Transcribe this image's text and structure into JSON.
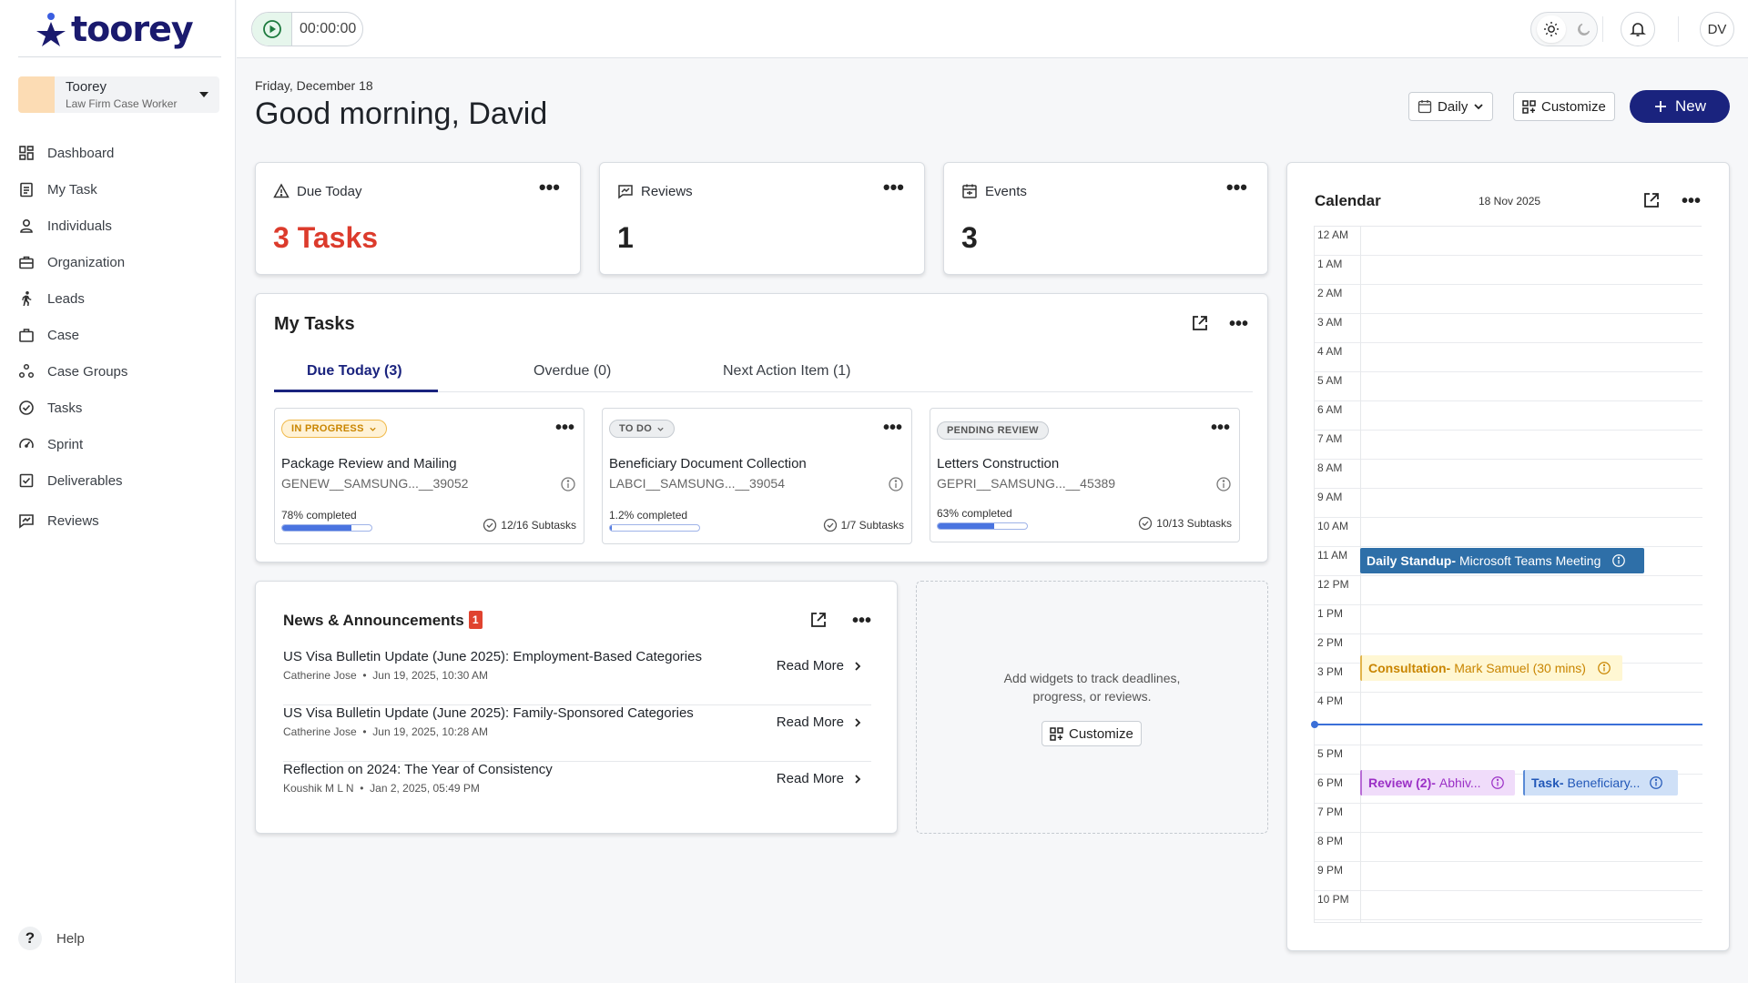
{
  "brand": {
    "name": "toorey",
    "color": "#1a1a6e"
  },
  "org": {
    "name": "Toorey",
    "role": "Law Firm Case Worker"
  },
  "nav": [
    {
      "label": "Dashboard",
      "icon": "dashboard-icon"
    },
    {
      "label": "My Task",
      "icon": "clipboard-icon"
    },
    {
      "label": "Individuals",
      "icon": "person-icon"
    },
    {
      "label": "Organization",
      "icon": "briefcase-icon"
    },
    {
      "label": "Leads",
      "icon": "walking-person-icon"
    },
    {
      "label": "Case",
      "icon": "case-icon"
    },
    {
      "label": "Case Groups",
      "icon": "groups-icon"
    },
    {
      "label": "Tasks",
      "icon": "check-circle-icon"
    },
    {
      "label": "Sprint",
      "icon": "gauge-icon"
    },
    {
      "label": "Deliverables",
      "icon": "checklist-icon"
    },
    {
      "label": "Reviews",
      "icon": "review-icon"
    }
  ],
  "help": {
    "label": "Help",
    "glyph": "?"
  },
  "topbar": {
    "timer": "00:00:00",
    "avatar_initials": "DV"
  },
  "header": {
    "date": "Friday, December 18",
    "greeting": "Good morning, David",
    "view_select": "Daily",
    "customize_label": "Customize",
    "new_label": "New"
  },
  "kpis": [
    {
      "label": "Due Today",
      "value": "3 Tasks",
      "icon": "warning-icon"
    },
    {
      "label": "Reviews",
      "value": "1",
      "icon": "review-icon"
    },
    {
      "label": "Events",
      "value": "3",
      "icon": "calendar-event-icon"
    }
  ],
  "my_tasks": {
    "title": "My Tasks",
    "tabs": [
      "Due Today (3)",
      "Overdue (0)",
      "Next Action Item (1)"
    ],
    "active_tab": 0,
    "cards": [
      {
        "status": "IN PROGRESS",
        "title": "Package Review and Mailing",
        "code": "GENEW__SAMSUNG...__39052",
        "progress_label": "78% completed",
        "progress": 0.78,
        "subtasks": "12/16 Subtasks"
      },
      {
        "status": "TO DO",
        "title": "Beneficiary Document Collection",
        "code": "LABCI__SAMSUNG...__39054",
        "progress_label": "1.2% completed",
        "progress": 0.012,
        "subtasks": "1/7 Subtasks"
      },
      {
        "status": "PENDING REVIEW",
        "title": "Letters Construction",
        "code": "GEPRI__SAMSUNG...__45389",
        "progress_label": "63% completed",
        "progress": 0.63,
        "subtasks": "10/13 Subtasks"
      }
    ]
  },
  "news": {
    "title": "News & Announcements",
    "badge": "1",
    "read_more": "Read More",
    "items": [
      {
        "title": "US Visa Bulletin Update (June 2025): Employment-Based Categories",
        "author": "Catherine Jose",
        "date": "Jun 19, 2025, 10:30 AM"
      },
      {
        "title": "US Visa Bulletin Update (June 2025): Family-Sponsored Categories",
        "author": "Catherine Jose",
        "date": "Jun 19, 2025, 10:28 AM"
      },
      {
        "title": "Reflection on 2024: The Year of Consistency",
        "author": "Koushik M L N",
        "date": "Jan 2, 2025, 05:49 PM"
      }
    ]
  },
  "empty_widget": {
    "line1": "Add widgets to track deadlines,",
    "line2": "progress, or reviews.",
    "button": "Customize"
  },
  "calendar": {
    "title": "Calendar",
    "date": "18 Nov 2025",
    "hours": [
      "12 AM",
      "1 AM",
      "2 AM",
      "3 AM",
      "4 AM",
      "5 AM",
      "6 AM",
      "7 AM",
      "8 AM",
      "9 AM",
      "10 AM",
      "11 AM",
      "12 PM",
      "1 PM",
      "2 PM",
      "3 PM",
      "4 PM",
      "5 PM",
      "6 PM",
      "7 PM",
      "8 PM",
      "9 PM",
      "10 PM"
    ],
    "events": [
      {
        "type": "Daily Standup-",
        "detail": "Microsoft Teams Meeting",
        "color": "#2e6fa8"
      },
      {
        "type": "Consultation-",
        "detail": "Mark Samuel (30 mins)",
        "color": "#e2b44b"
      },
      {
        "type": "Review (2)-",
        "detail": "Abhiv...",
        "color": "#b86bd6"
      },
      {
        "type": "Task-",
        "detail": "Beneficiary...",
        "color": "#5a8ad6"
      }
    ]
  },
  "colors": {
    "accent": "#1a237e",
    "danger": "#dc3b2c",
    "progress": "#4a74e0"
  }
}
